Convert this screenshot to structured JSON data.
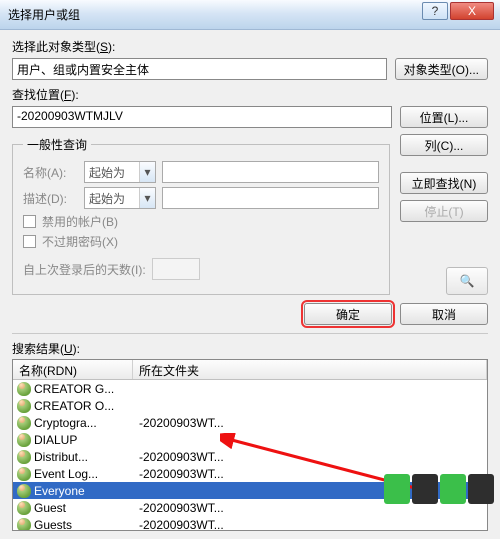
{
  "window": {
    "title": "选择用户或组",
    "help_glyph": "?",
    "close_glyph": "X"
  },
  "section_type": {
    "label_pre": "选择此对象类型(",
    "label_hot": "S",
    "label_post": "):",
    "value": "用户、组或内置安全主体",
    "button": "对象类型(O)..."
  },
  "section_location": {
    "label_pre": "查找位置(",
    "label_hot": "F",
    "label_post": "):",
    "value": "-20200903WTMJLV",
    "button": "位置(L)..."
  },
  "groupbox": {
    "legend": "一般性查询",
    "name_label": "名称(A):",
    "desc_label": "描述(D):",
    "combo_value": "起始为",
    "chk_disabled_acct": "禁用的帐户(B)",
    "chk_no_expire": "不过期密码(X)",
    "days_label": "自上次登录后的天数(I):",
    "side": {
      "columns": "列(C)...",
      "find_now": "立即查找(N)",
      "stop": "停止(T)"
    }
  },
  "actions": {
    "ok": "确定",
    "cancel": "取消"
  },
  "results": {
    "label_pre": "搜索结果(",
    "label_hot": "U",
    "label_post": "):",
    "col_name": "名称(RDN)",
    "col_folder": "所在文件夹",
    "rows": [
      {
        "name": "CREATOR G...",
        "folder": "",
        "selected": false
      },
      {
        "name": "CREATOR O...",
        "folder": "",
        "selected": false
      },
      {
        "name": "Cryptogra...",
        "folder": "-20200903WT...",
        "selected": false
      },
      {
        "name": "DIALUP",
        "folder": "",
        "selected": false
      },
      {
        "name": "Distribut...",
        "folder": "-20200903WT...",
        "selected": false
      },
      {
        "name": "Event Log...",
        "folder": "-20200903WT...",
        "selected": false
      },
      {
        "name": "Everyone",
        "folder": "",
        "selected": true
      },
      {
        "name": "Guest",
        "folder": "-20200903WT...",
        "selected": false
      },
      {
        "name": "Guests",
        "folder": "-20200903WT...",
        "selected": false
      }
    ]
  },
  "icons": {
    "search": "🔍"
  }
}
